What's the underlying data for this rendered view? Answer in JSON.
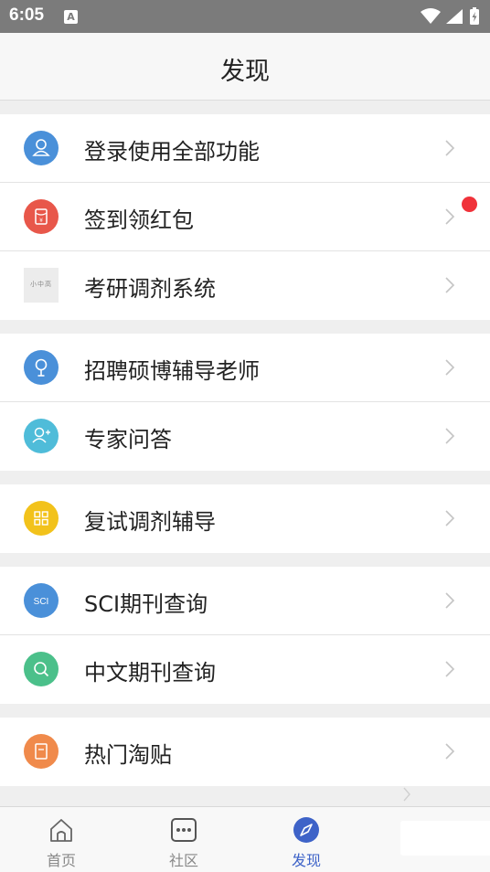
{
  "status_bar": {
    "time": "6:05",
    "notification_letter": "A"
  },
  "header": {
    "title": "发现"
  },
  "groups": [
    {
      "items": [
        {
          "label": "登录使用全部功能",
          "icon": "user-icon",
          "color": "#4a90d9"
        },
        {
          "label": "签到领红包",
          "icon": "red-envelope-icon",
          "color": "#e8574a",
          "badge": "red-dot"
        },
        {
          "label": "考研调剂系统",
          "icon": "thumbnail-image",
          "thumb_text": "小中高"
        }
      ]
    },
    {
      "items": [
        {
          "label": "招聘硕博辅导老师",
          "icon": "microphone-icon",
          "color": "#4a90d9"
        },
        {
          "label": "专家问答",
          "icon": "user-add-icon",
          "color": "#4fbcd9"
        }
      ]
    },
    {
      "items": [
        {
          "label": "复试调剂辅导",
          "icon": "grid-icon",
          "color": "#f2c21b"
        }
      ]
    },
    {
      "items": [
        {
          "label": "SCI期刊查询",
          "icon": "sci-icon",
          "icon_text": "SCI",
          "color": "#4a90d9"
        },
        {
          "label": "中文期刊查询",
          "icon": "search-icon",
          "color": "#4bc08a"
        }
      ]
    },
    {
      "items": [
        {
          "label": "热门淘贴",
          "icon": "document-icon",
          "color": "#f08a4b"
        }
      ]
    }
  ],
  "tabbar": {
    "tabs": [
      {
        "label": "首页",
        "icon": "home-icon",
        "active": false
      },
      {
        "label": "社区",
        "icon": "chat-icon",
        "active": false
      },
      {
        "label": "发现",
        "icon": "compass-icon",
        "active": true
      }
    ]
  },
  "colors": {
    "accent": "#3e63c8",
    "badge": "#f0323a",
    "status_bar": "#7b7b7b"
  }
}
